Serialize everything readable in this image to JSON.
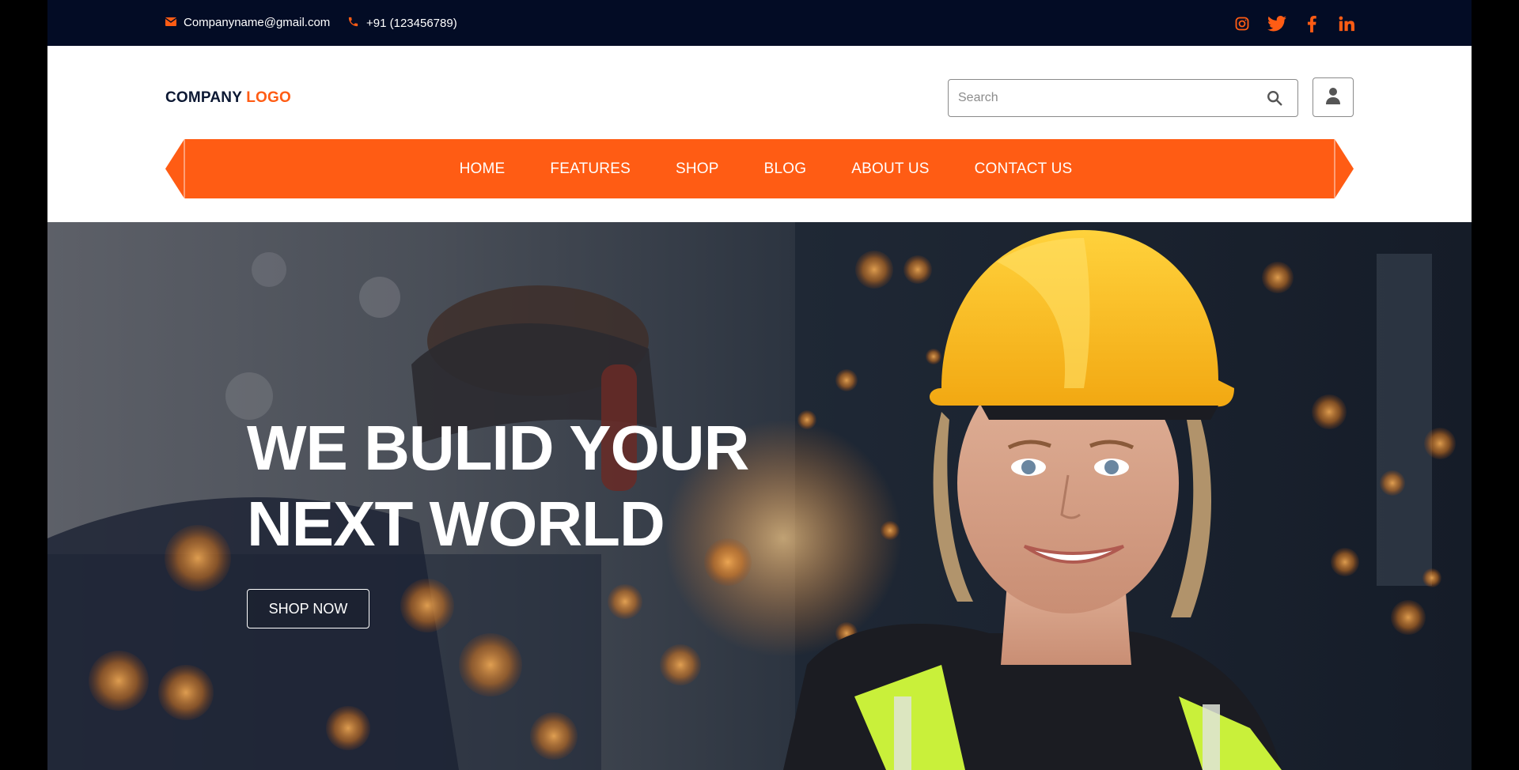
{
  "topbar": {
    "email": "Companyname@gmail.com",
    "phone": "+91 (123456789)",
    "socials": [
      "instagram-icon",
      "twitter-icon",
      "facebook-icon",
      "linkedin-icon"
    ]
  },
  "header": {
    "logo_part1": "COMPANY",
    "logo_part2": "LOGO",
    "search_placeholder": "Search"
  },
  "nav": {
    "items": [
      "HOME",
      "FEATURES",
      "SHOP",
      "BLOG",
      "ABOUT US",
      "CONTACT US"
    ]
  },
  "hero": {
    "headline_line1": "WE BULID YOUR",
    "headline_line2": "NEXT WORLD",
    "cta_label": "SHOP NOW"
  },
  "colors": {
    "accent": "#ff5c14",
    "topbar_bg": "#030c25",
    "logo_dark": "#0c1833",
    "helmet": "#f7b81d",
    "vest": "#c9f03a"
  }
}
